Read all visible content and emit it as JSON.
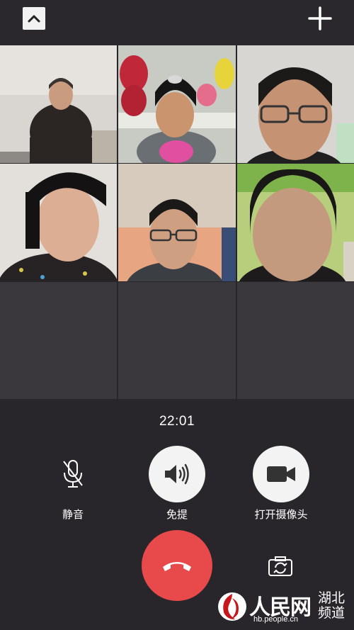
{
  "header": {
    "collapse_icon": "chevron-up-icon",
    "add_icon": "plus-icon"
  },
  "participants": [
    {
      "name": "participant-1",
      "status": "video"
    },
    {
      "name": "participant-2",
      "status": "video"
    },
    {
      "name": "participant-3",
      "status": "video"
    },
    {
      "name": "participant-4",
      "status": "video"
    },
    {
      "name": "participant-5",
      "status": "video"
    },
    {
      "name": "participant-6",
      "status": "video"
    }
  ],
  "call": {
    "duration": "22:01"
  },
  "controls": {
    "mute_label": "静音",
    "speaker_label": "免提",
    "camera_label": "打开摄像头"
  },
  "colors": {
    "background": "#29262b",
    "empty_tile": "#3a383d",
    "hangup": "#e8494a",
    "button_white": "#f3f3f3"
  },
  "watermark": {
    "name": "人民网",
    "region": "湖北频道",
    "url": "hb.people.cn"
  }
}
